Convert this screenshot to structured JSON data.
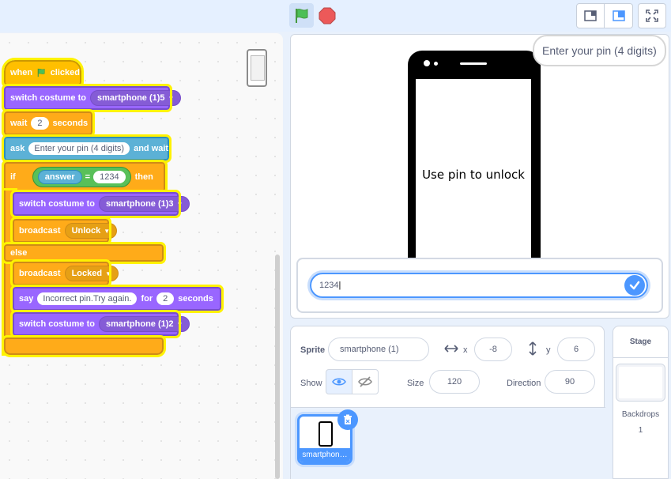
{
  "colors": {
    "accent": "#4c97ff",
    "events": "#ffbf00",
    "control": "#ffab19",
    "looks": "#9966ff",
    "sensing": "#5cb1d6",
    "highlight": "#fff200"
  },
  "toolbar": {
    "green_flag": "green-flag-icon",
    "stop": "stop-icon"
  },
  "script": {
    "when_label": "when",
    "clicked_label": "clicked",
    "switch1": {
      "label": "switch costume to",
      "costume": "smartphone (1)5"
    },
    "wait": {
      "label": "wait",
      "value": "2",
      "unit": "seconds"
    },
    "ask": {
      "label": "ask",
      "question": "Enter your pin (4 digits)",
      "suffix": "and wait"
    },
    "if_block": {
      "label": "if",
      "reporter": "answer",
      "op": "=",
      "value": "1234",
      "then": "then"
    },
    "switch2": {
      "label": "switch costume to",
      "costume": "smartphone (1)3"
    },
    "broadcast1": {
      "label": "broadcast",
      "message": "Unlock"
    },
    "else_label": "else",
    "broadcast2": {
      "label": "broadcast",
      "message": "Locked"
    },
    "say": {
      "label": "say",
      "message": "Incorrect pin.Try again.",
      "for": "for",
      "secs": "2",
      "unit": "seconds"
    },
    "switch3": {
      "label": "switch costume to",
      "costume": "smartphone (1)2"
    }
  },
  "stage": {
    "phone_text": "Use pin to unlock",
    "bubble": "Enter your pin (4 digits)",
    "answer_value": "1234"
  },
  "sprite_info": {
    "sprite_label": "Sprite",
    "sprite_name": "smartphone (1)",
    "x_label": "x",
    "x_value": "-8",
    "y_label": "y",
    "y_value": "6",
    "show_label": "Show",
    "size_label": "Size",
    "size_value": "120",
    "direction_label": "Direction",
    "direction_value": "90"
  },
  "sprite_list": {
    "tile_label": "smartphon…"
  },
  "stage_pane": {
    "title": "Stage",
    "backdrops_label": "Backdrops",
    "backdrops_count": "1"
  }
}
